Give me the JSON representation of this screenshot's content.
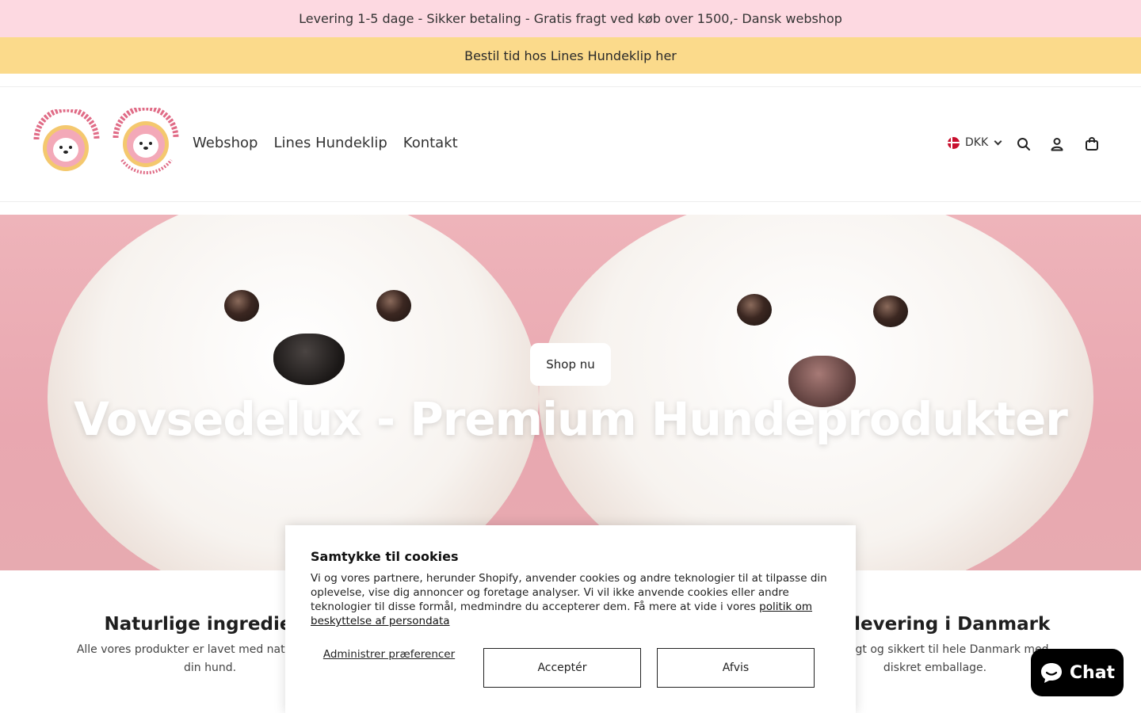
{
  "announcement": {
    "text": "Levering 1-5 dage - Sikker betaling - Gratis fragt ved køb over 1500,- Dansk webshop",
    "bg": "#fdd9e1"
  },
  "promo": {
    "text": "Bestil tid hos Lines Hundeklip her",
    "bg": "#fbda8b"
  },
  "header": {
    "nav": [
      {
        "label": "Webshop"
      },
      {
        "label": "Lines Hundeklip"
      },
      {
        "label": "Kontakt"
      }
    ],
    "currency": "DKK",
    "icons": [
      "danish-flag-icon",
      "search-icon",
      "account-icon",
      "cart-icon"
    ]
  },
  "hero": {
    "button": "Shop nu",
    "title": "Vovsedelux - Premium Hundeprodukter"
  },
  "features": [
    {
      "title": "Naturlige ingrediens",
      "text_line1": "Alle vores produkter er lavet med naturlige og s",
      "text_line2": "din hund."
    },
    {
      "title": "tig levering i Danmark",
      "text_line1": "r hurtigt og sikkert til hele Danmark med",
      "text_line2": "diskret emballage."
    }
  ],
  "cookie": {
    "title": "Samtykke til cookies",
    "body": "Vi og vores partnere, herunder Shopify, anvender cookies og andre teknologier til at tilpasse din oplevelse, vise dig annoncer og foretage analyser. Vi vil ikke anvende cookies eller andre teknologier til disse formål, medmindre du accepterer dem. Få mere at vide i vores ",
    "link": "politik om beskyttelse af persondata",
    "manage": "Administrer præferencer",
    "accept": "Acceptér",
    "decline": "Afvis"
  },
  "chat": {
    "label": "Chat"
  },
  "colors": {
    "hero_bg": "#eaa9b1",
    "chat_bg": "#000000"
  }
}
